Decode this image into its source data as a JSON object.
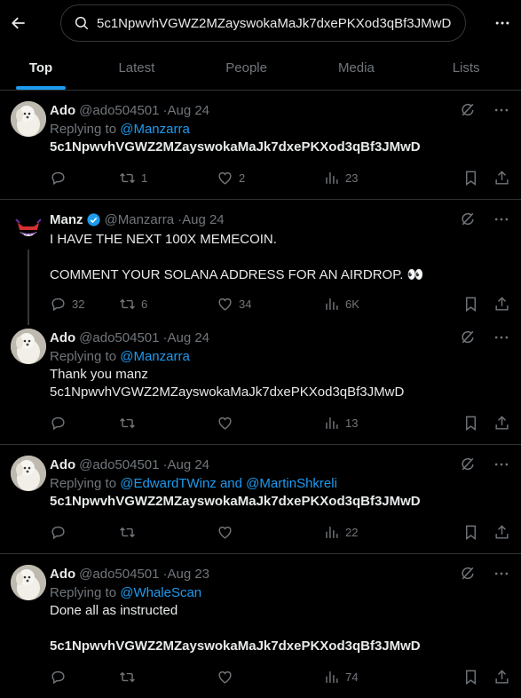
{
  "search": {
    "query": "5c1NpwvhVGWZ2MZayswokaMaJk7dxePKXod3qBf3JMwD"
  },
  "tabs": [
    "Top",
    "Latest",
    "People",
    "Media",
    "Lists"
  ],
  "tweets": [
    {
      "name": "Ado",
      "handle": "@ado504501",
      "date": "Aug 24",
      "reply_prefix": "Replying to ",
      "reply_to": "@Manzarra",
      "text": "5c1NpwvhVGWZ2MZayswokaMaJk7dxePKXod3qBf3JMwD",
      "replies": "",
      "retweets": "1",
      "likes": "2",
      "views": "23"
    },
    {
      "name": "Manz",
      "handle": "@Manzarra",
      "date": "Aug 24",
      "text": "I HAVE THE NEXT 100X MEMECOIN.\n\nCOMMENT YOUR SOLANA ADDRESS FOR AN AIRDROP. 👀",
      "replies": "32",
      "retweets": "6",
      "likes": "34",
      "views": "6K"
    },
    {
      "name": "Ado",
      "handle": "@ado504501",
      "date": "Aug 24",
      "reply_prefix": "Replying to ",
      "reply_to": "@Manzarra",
      "text": "Thank you manz\n5c1NpwvhVGWZ2MZayswokaMaJk7dxePKXod3qBf3JMwD",
      "replies": "",
      "retweets": "",
      "likes": "",
      "views": "13"
    },
    {
      "name": "Ado",
      "handle": "@ado504501",
      "date": "Aug 24",
      "reply_prefix": "Replying to ",
      "reply_to": "@EdwardTWinz and @MartinShkreli",
      "text": "5c1NpwvhVGWZ2MZayswokaMaJk7dxePKXod3qBf3JMwD",
      "replies": "",
      "retweets": "",
      "likes": "",
      "views": "22"
    },
    {
      "name": "Ado",
      "handle": "@ado504501",
      "date": "Aug 23",
      "reply_prefix": "Replying to ",
      "reply_to": "@WhaleScan",
      "text": "Done all as instructed",
      "text2": "5c1NpwvhVGWZ2MZayswokaMaJk7dxePKXod3qBf3JMwD",
      "replies": "",
      "retweets": "",
      "likes": "",
      "views": "74"
    }
  ],
  "separator": " · ",
  "colors": {
    "accent": "#1d9bf0",
    "muted": "#71767b",
    "border": "#2f3336"
  }
}
